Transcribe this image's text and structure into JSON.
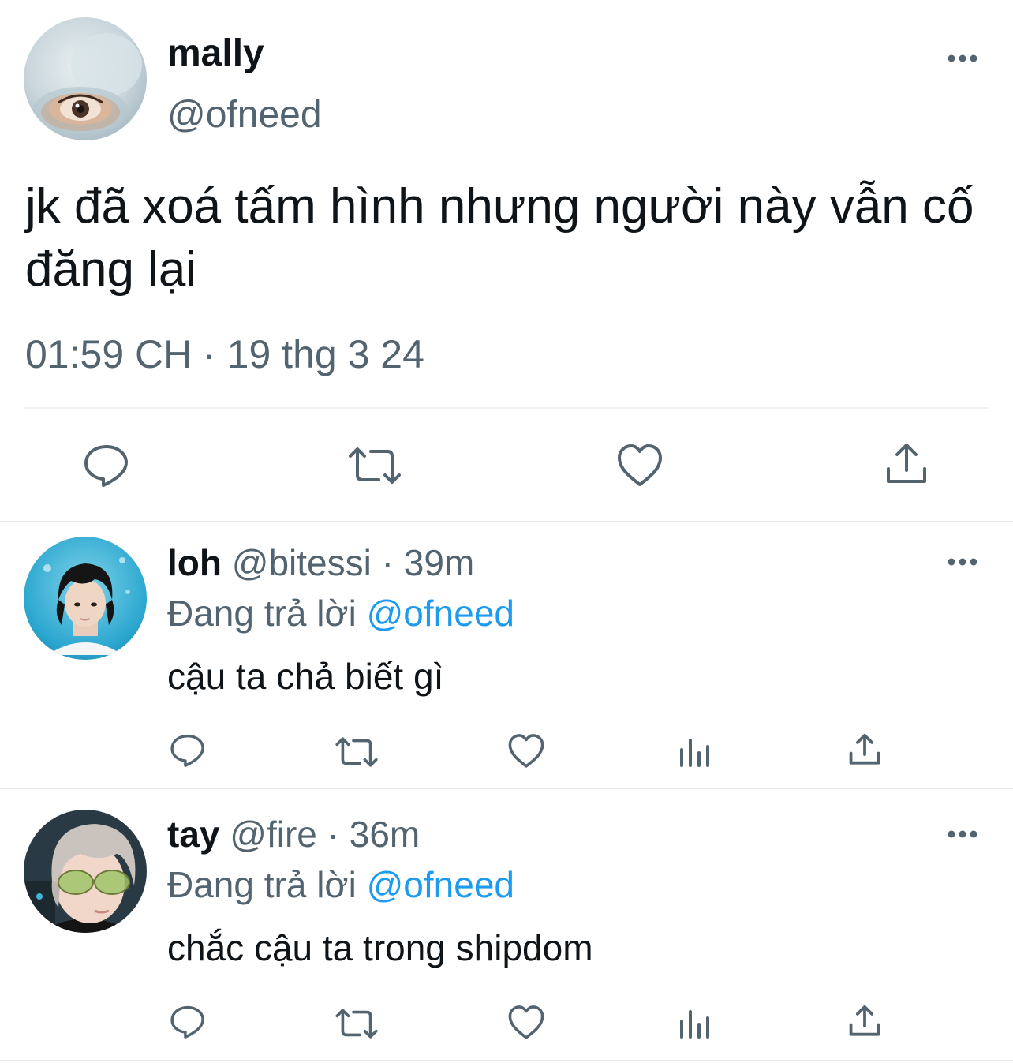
{
  "main_tweet": {
    "display_name": "mally",
    "handle": "@ofneed",
    "text": "jk đã xoá tấm hình nhưng người này vẫn cố đăng lại",
    "timestamp": "01:59 CH · 19 thg 3 24",
    "actions": [
      "reply-icon",
      "retweet-icon",
      "like-icon",
      "share-icon"
    ]
  },
  "replies": [
    {
      "display_name": "loh",
      "handle": "@bitessi",
      "separator": " · ",
      "age": "39m",
      "replying_label": "Đang trả lời ",
      "replying_to": "@ofneed",
      "text": "cậu ta chả biết gì"
    },
    {
      "display_name": "tay",
      "handle": "@fire",
      "separator": " · ",
      "age": "36m",
      "replying_label": "Đang trả lời ",
      "replying_to": "@ofneed",
      "text": "chắc cậu ta trong shipdom"
    }
  ],
  "colors": {
    "text": "#0f1419",
    "secondary": "#536471",
    "accent": "#1d9bf0",
    "divider": "#eff3f4"
  }
}
